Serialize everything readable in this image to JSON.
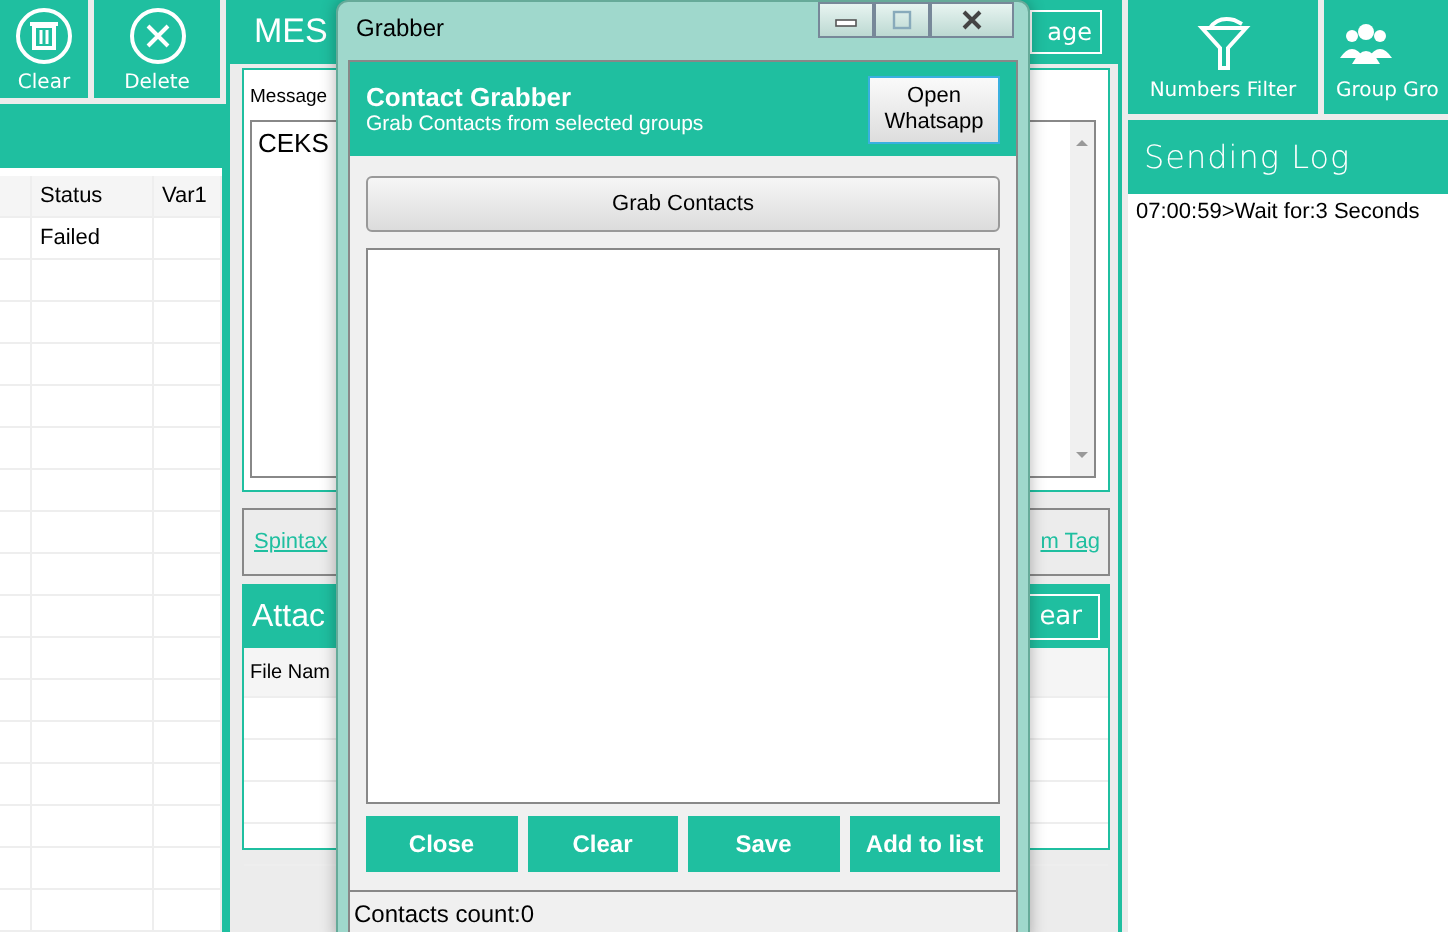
{
  "left_toolbar": [
    {
      "label": "Clear",
      "kind": "trash"
    },
    {
      "label": "Delete",
      "kind": "delete"
    }
  ],
  "numbers_table": {
    "columns": [
      "Status",
      "Var1"
    ],
    "rows": [
      [
        "Failed"
      ]
    ]
  },
  "message_panel": {
    "title": "MES",
    "button": "age",
    "tab": "Message",
    "text": "CEKS"
  },
  "links": [
    "Spintax",
    "m Tag"
  ],
  "attachments": {
    "title": "Attac",
    "button": "ear",
    "columns": [
      "File Nam"
    ]
  },
  "right_toolbar": [
    {
      "label": "Numbers Filter",
      "kind": "filter"
    },
    {
      "label": "Group Gro",
      "kind": "group"
    }
  ],
  "sending_log": {
    "title": "Sending Log",
    "lines": [
      "07:00:59>Wait for:3 Seconds"
    ]
  },
  "dialog": {
    "title": "Grabber",
    "header": {
      "title": "Contact Grabber",
      "subtitle": "Grab Contacts from selected groups"
    },
    "open_button": "Open Whatsapp",
    "grab_button": "Grab Contacts",
    "buttons": [
      "Close",
      "Clear",
      "Save",
      "Add to list"
    ],
    "status": "Contacts count:0"
  }
}
